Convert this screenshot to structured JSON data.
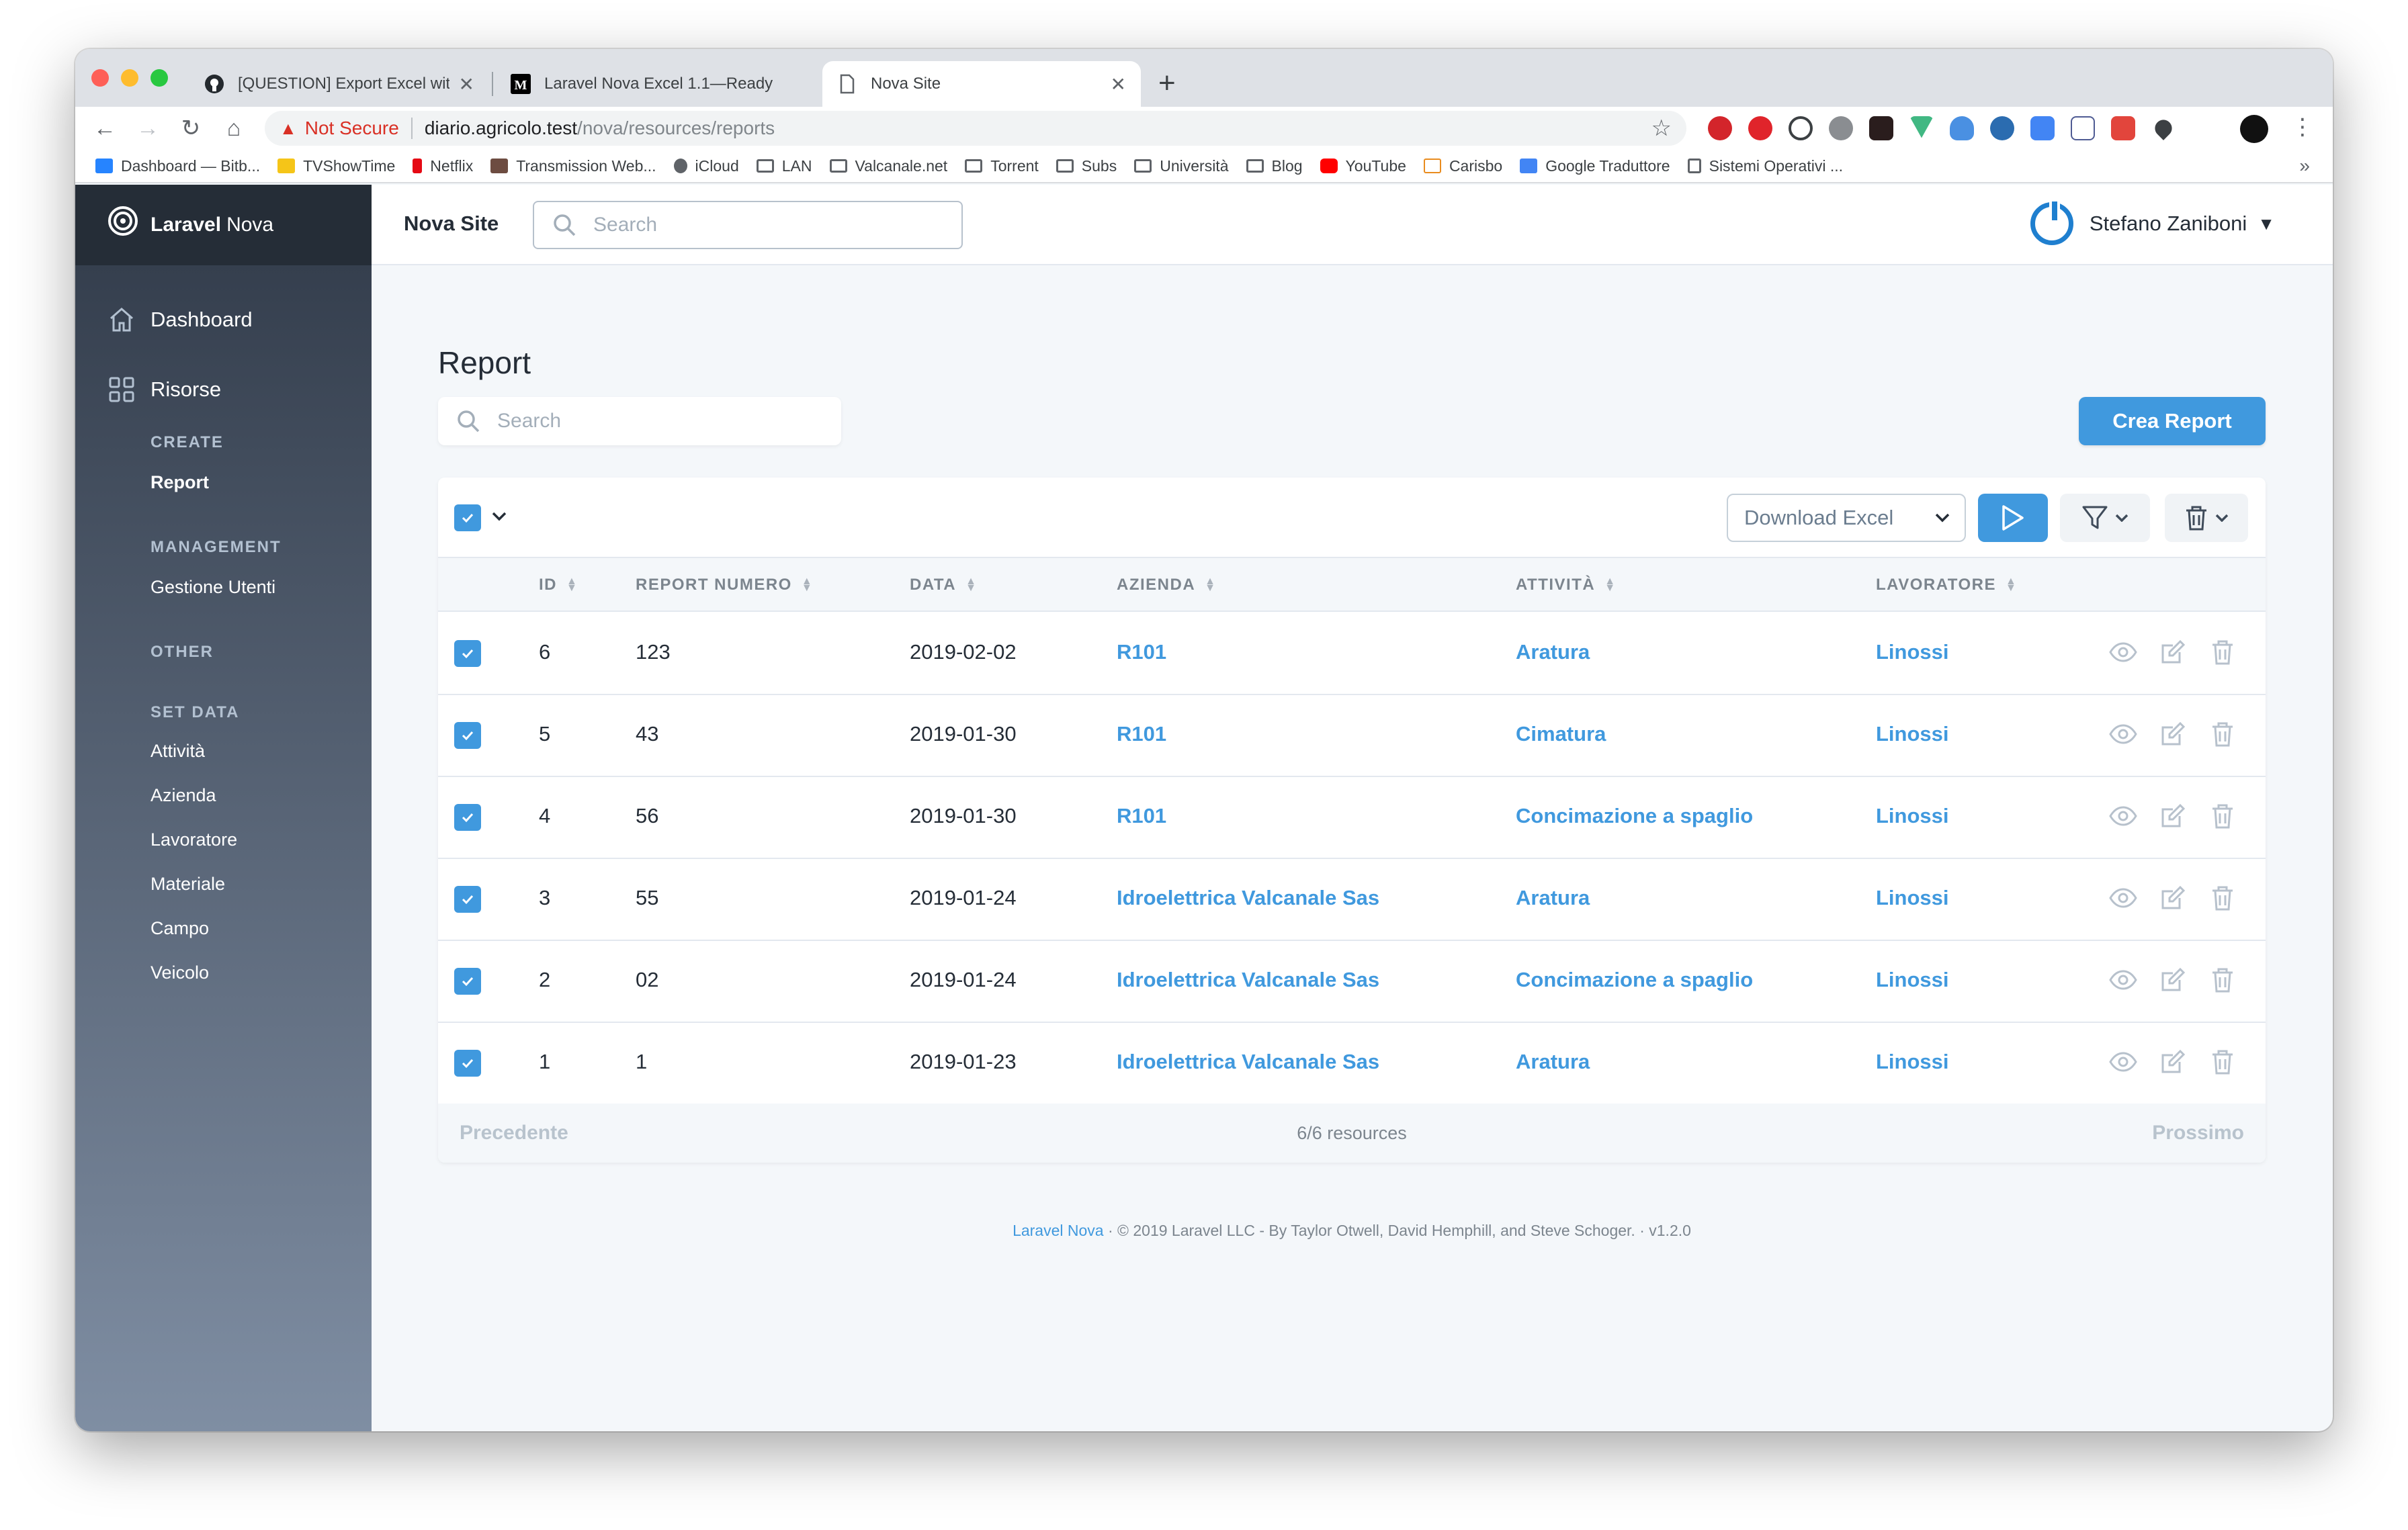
{
  "browser": {
    "tabs": [
      {
        "title": "[QUESTION] Export Excel with",
        "icon": "github-icon"
      },
      {
        "title": "Laravel Nova Excel 1.1—Ready",
        "icon": "medium-icon"
      },
      {
        "title": "Nova Site",
        "icon": "page-icon"
      }
    ],
    "address": {
      "security": "Not Secure",
      "host": "diario.agricolo.test",
      "path": "/nova/resources/reports"
    },
    "bookmarks": [
      "Dashboard — Bitb...",
      "TVShowTime",
      "Netflix",
      "Transmission Web...",
      "iCloud",
      "LAN",
      "Valcanale.net",
      "Torrent",
      "Subs",
      "Università",
      "Blog",
      "YouTube",
      "Carisbo",
      "Google Traduttore",
      "Sistemi Operativi ..."
    ]
  },
  "app": {
    "logo": {
      "brand": "Laravel",
      "product": "Nova"
    },
    "site_title": "Nova Site",
    "search_placeholder": "Search",
    "user_name": "Stefano Zaniboni"
  },
  "sidebar": {
    "dashboard": "Dashboard",
    "resources": "Risorse",
    "sections": [
      {
        "title": "CREATE",
        "items": [
          "Report"
        ]
      },
      {
        "title": "MANAGEMENT",
        "items": [
          "Gestione Utenti"
        ]
      },
      {
        "title": "OTHER",
        "items": []
      },
      {
        "title": "SET DATA",
        "items": [
          "Attività",
          "Azienda",
          "Lavoratore",
          "Materiale",
          "Campo",
          "Veicolo"
        ]
      }
    ]
  },
  "page": {
    "title": "Report",
    "search_placeholder": "Search",
    "create_button": "Crea Report",
    "action_selected": "Download Excel"
  },
  "table": {
    "columns": [
      "ID",
      "REPORT NUMERO",
      "DATA",
      "AZIENDA",
      "ATTIVITÀ",
      "LAVORATORE"
    ],
    "rows": [
      {
        "id": "6",
        "numero": "123",
        "data": "2019-02-02",
        "azienda": "R101",
        "attivita": "Aratura",
        "lavoratore": "Linossi"
      },
      {
        "id": "5",
        "numero": "43",
        "data": "2019-01-30",
        "azienda": "R101",
        "attivita": "Cimatura",
        "lavoratore": "Linossi"
      },
      {
        "id": "4",
        "numero": "56",
        "data": "2019-01-30",
        "azienda": "R101",
        "attivita": "Concimazione a spaglio",
        "lavoratore": "Linossi"
      },
      {
        "id": "3",
        "numero": "55",
        "data": "2019-01-24",
        "azienda": "Idroelettrica Valcanale Sas",
        "attivita": "Aratura",
        "lavoratore": "Linossi"
      },
      {
        "id": "2",
        "numero": "02",
        "data": "2019-01-24",
        "azienda": "Idroelettrica Valcanale Sas",
        "attivita": "Concimazione a spaglio",
        "lavoratore": "Linossi"
      },
      {
        "id": "1",
        "numero": "1",
        "data": "2019-01-23",
        "azienda": "Idroelettrica Valcanale Sas",
        "attivita": "Aratura",
        "lavoratore": "Linossi"
      }
    ],
    "pagination": {
      "prev": "Precedente",
      "count": "6/6 resources",
      "next": "Prossimo"
    }
  },
  "footer": {
    "link": "Laravel Nova",
    "text": "· © 2019 Laravel LLC - By Taylor Otwell, David Hemphill, and Steve Schoger. · v1.2.0"
  },
  "colors": {
    "primary": "#4099de",
    "sidebar_dark": "#252d37",
    "text": "#252d37"
  }
}
